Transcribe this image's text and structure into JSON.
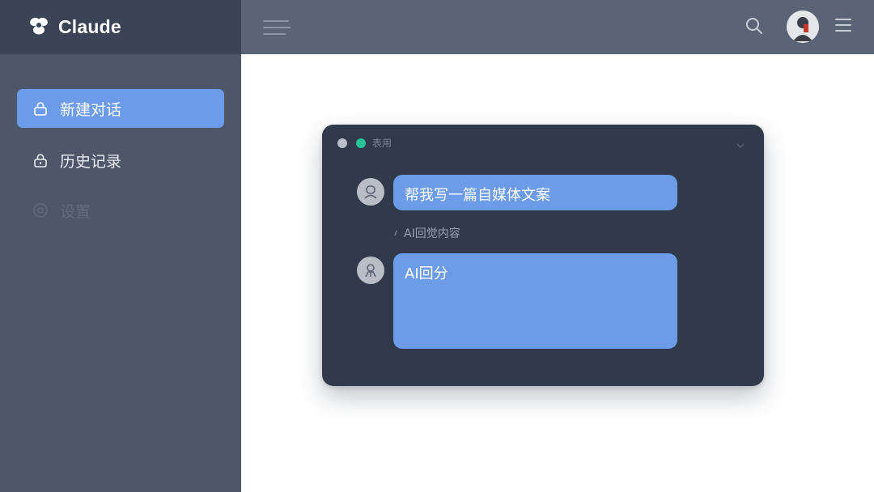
{
  "app": {
    "brand": "Claude"
  },
  "sidebar": {
    "items": [
      {
        "label": "新建对话",
        "icon": "lock-icon",
        "state": "active"
      },
      {
        "label": "历史记录",
        "icon": "lock-icon",
        "state": "normal"
      },
      {
        "label": "设置",
        "icon": "settings-icon",
        "state": "disabled"
      }
    ]
  },
  "topbar": {
    "icons": [
      "hamburger-icon",
      "search-icon",
      "avatar",
      "menu-icon"
    ]
  },
  "chat_window": {
    "title": "表用",
    "messages": [
      {
        "role": "user",
        "text": "帮我写一篇自媒体文案"
      },
      {
        "role": "caption",
        "text": "AI回觉内容"
      },
      {
        "role": "ai",
        "text": "AI回分"
      }
    ]
  },
  "colors": {
    "sidebar_bg": "#4d5769",
    "sidebar_header_bg": "#3a4456",
    "topbar_bg": "#5b6476",
    "accent": "#6b9be9",
    "window_bg": "#303a4a",
    "status_green": "#28c39a"
  }
}
